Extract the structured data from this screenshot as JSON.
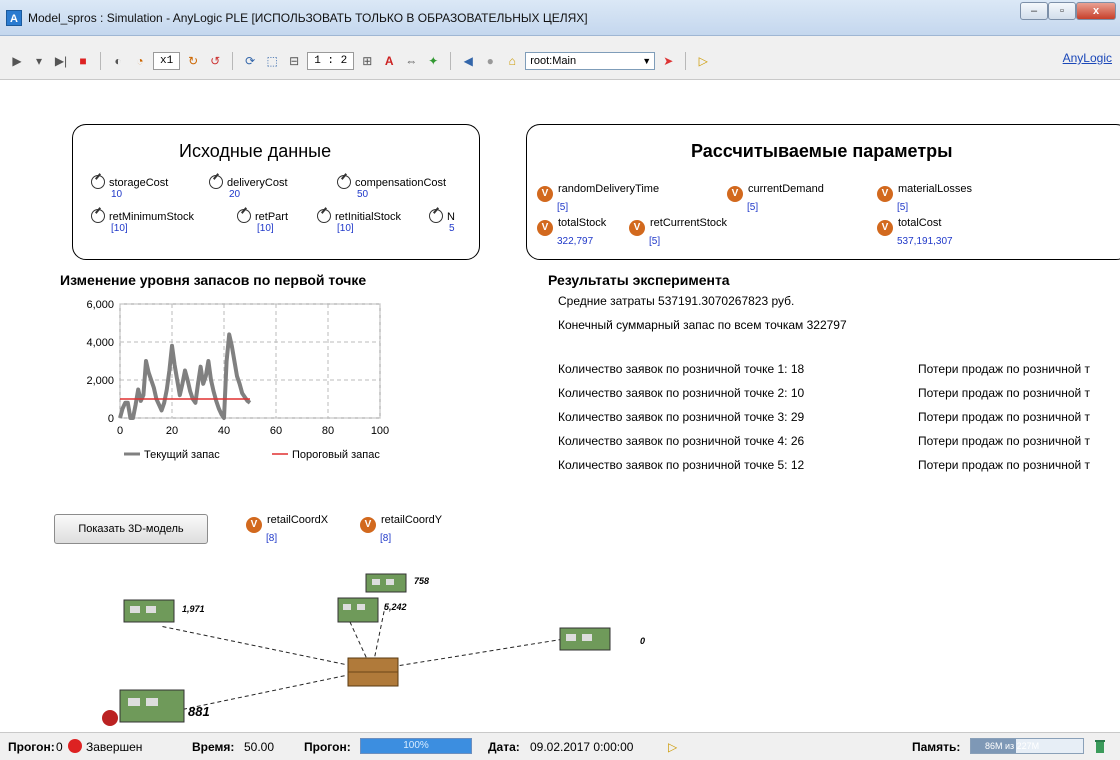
{
  "window": {
    "title": "Model_spros : Simulation - AnyLogic PLE [ИСПОЛЬЗОВАТЬ ТОЛЬКО В ОБРАЗОВАТЕЛЬНЫХ ЦЕЛЯХ]",
    "app_icon": "anylogic-icon"
  },
  "toolbar": {
    "speed": "x1",
    "scale": "1 : 2",
    "navigation": "root:Main",
    "anylogic_link": "AnyLogic"
  },
  "inputs": {
    "title": "Исходные данные",
    "params": [
      {
        "name": "storageCost",
        "value": "10"
      },
      {
        "name": "deliveryCost",
        "value": "20"
      },
      {
        "name": "compensationCost",
        "value": "50"
      },
      {
        "name": "retMinimumStock",
        "value": "[10]"
      },
      {
        "name": "retPart",
        "value": "[10]"
      },
      {
        "name": "retInitialStock",
        "value": "[10]"
      },
      {
        "name": "N",
        "value": "5"
      }
    ]
  },
  "computed": {
    "title": "Рассчитываемые параметры",
    "vars": [
      {
        "name": "randomDeliveryTime",
        "value": "[5]"
      },
      {
        "name": "currentDemand",
        "value": "[5]"
      },
      {
        "name": "materialLosses",
        "value": "[5]"
      },
      {
        "name": "totalStock",
        "value": "322,797"
      },
      {
        "name": "retCurrentStock",
        "value": "[5]"
      },
      {
        "name": "totalCost",
        "value": "537,191,307"
      }
    ]
  },
  "chart_section_title": "Изменение уровня запасов по первой точке",
  "chart_data": {
    "type": "line",
    "x": [
      0,
      1,
      2,
      3,
      4,
      5,
      6,
      7,
      8,
      9,
      10,
      11,
      12,
      13,
      14,
      15,
      16,
      17,
      18,
      19,
      20,
      21,
      22,
      23,
      24,
      25,
      26,
      27,
      28,
      29,
      30,
      31,
      32,
      33,
      34,
      35,
      36,
      37,
      38,
      39,
      40,
      41,
      42,
      43,
      44,
      45,
      46,
      47,
      48,
      49,
      50
    ],
    "series": [
      {
        "name": "Текущий запас",
        "color": "#808080",
        "values": [
          0,
          500,
          800,
          800,
          0,
          0,
          700,
          1500,
          900,
          1200,
          3000,
          2400,
          2000,
          1600,
          1000,
          700,
          400,
          800,
          1500,
          2500,
          3800,
          2800,
          2000,
          1200,
          1800,
          2500,
          2000,
          1400,
          1000,
          800,
          1800,
          2700,
          1800,
          2200,
          3000,
          2000,
          1400,
          900,
          500,
          200,
          0,
          3000,
          4400,
          3800,
          3000,
          2200,
          1800,
          1300,
          1100,
          900,
          800
        ]
      },
      {
        "name": "Пороговый запас",
        "color": "#e03030",
        "values": [
          1000,
          1000,
          1000,
          1000,
          1000,
          1000,
          1000,
          1000,
          1000,
          1000,
          1000,
          1000,
          1000,
          1000,
          1000,
          1000,
          1000,
          1000,
          1000,
          1000,
          1000,
          1000,
          1000,
          1000,
          1000,
          1000,
          1000,
          1000,
          1000,
          1000,
          1000,
          1000,
          1000,
          1000,
          1000,
          1000,
          1000,
          1000,
          1000,
          1000,
          1000,
          1000,
          1000,
          1000,
          1000,
          1000,
          1000,
          1000,
          1000,
          1000,
          1000
        ]
      }
    ],
    "xlim": [
      0,
      100
    ],
    "ylim": [
      0,
      6000
    ],
    "x_ticks": [
      "0",
      "20",
      "40",
      "60",
      "80",
      "100"
    ],
    "y_ticks": [
      "0",
      "2,000",
      "4,000",
      "6,000"
    ],
    "grid": true,
    "legend_placement": "bottom"
  },
  "results": {
    "title": "Результаты эксперимента",
    "avg_cost": "Средние затраты 537191.3070267823 руб.",
    "final_stock": "Конечный суммарный запас по всем точкам 322797",
    "orders": [
      "Количество заявок по розничной точке 1: 18",
      "Количество заявок по розничной точке 2: 10",
      "Количество заявок по розничной точке 3: 29",
      "Количество заявок по розничной точке 4: 26",
      "Количество заявок по розничной точке 5: 12"
    ],
    "losses": [
      "Потери продаж по розничной т",
      "Потери продаж по розничной т",
      "Потери продаж по розничной т",
      "Потери продаж по розничной т",
      "Потери продаж по розничной т"
    ]
  },
  "show_3d_button": "Показать 3D-модель",
  "coord_vars": [
    {
      "name": "retailCoordX",
      "value": "[8]"
    },
    {
      "name": "retailCoordY",
      "value": "[8]"
    }
  ],
  "map_labels": [
    "758",
    "1,971",
    "5,242",
    "0",
    "881"
  ],
  "status": {
    "run_label": "Прогон:",
    "run_value": "0",
    "state": "Завершен",
    "time_label": "Время:",
    "time_value": "50.00",
    "progress_label": "Прогон:",
    "progress_value": "100%",
    "date_label": "Дата:",
    "date_value": "09.02.2017 0:00:00",
    "memory_label": "Память:",
    "memory_value": "86M из 227M"
  }
}
